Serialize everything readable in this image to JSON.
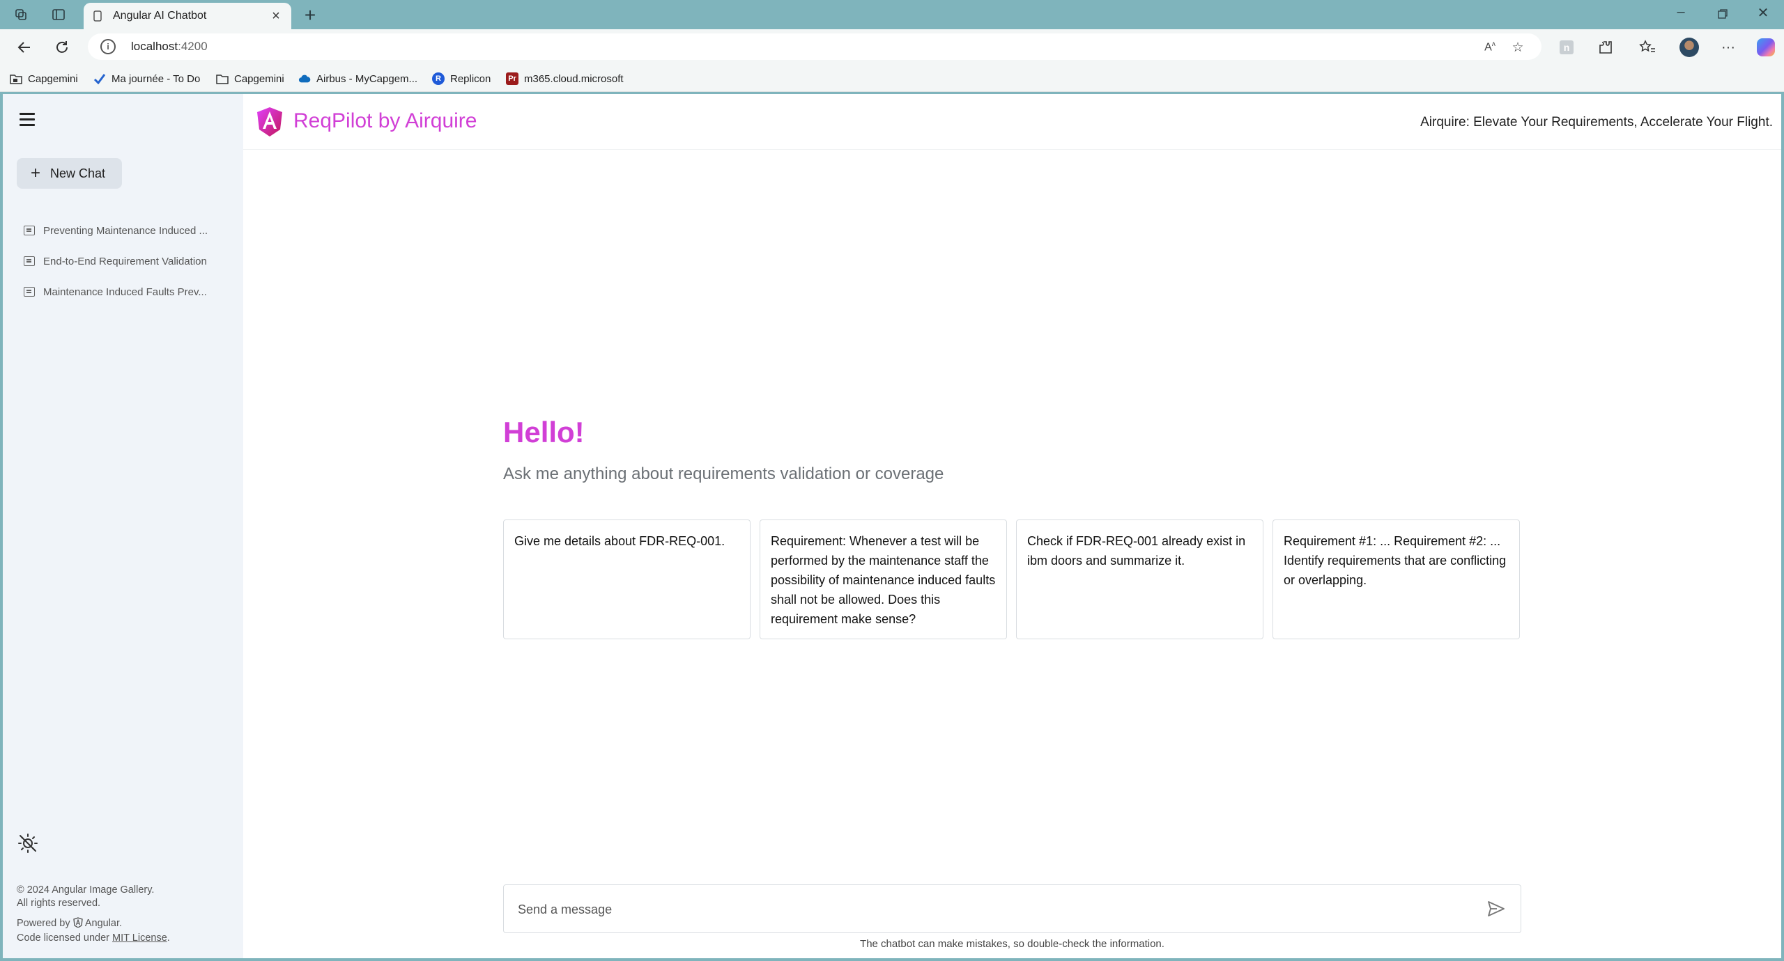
{
  "browser": {
    "tab_title": "Angular AI Chatbot",
    "url_host": "localhost",
    "url_port": ":4200",
    "bookmarks": [
      {
        "label": "Capgemini",
        "icon": "folder-lock-icon",
        "color": "#333333"
      },
      {
        "label": "Ma journée - To Do",
        "icon": "check-icon",
        "color": "#2564cf"
      },
      {
        "label": "Capgemini",
        "icon": "folder-icon",
        "color": "#333333"
      },
      {
        "label": "Airbus - MyCapgem...",
        "icon": "cloud-icon",
        "color": "#0f6cbd"
      },
      {
        "label": "Replicon",
        "icon": "replicon-icon",
        "color": "#1e5ad8"
      },
      {
        "label": "m365.cloud.microsoft",
        "icon": "pr-icon",
        "color": "#9b1c1c"
      }
    ]
  },
  "sidebar": {
    "new_chat_label": "New Chat",
    "history": [
      {
        "label": "Preventing Maintenance Induced ..."
      },
      {
        "label": "End-to-End Requirement Validation"
      },
      {
        "label": "Maintenance Induced Faults Prev..."
      }
    ],
    "footer": {
      "copyright_line1": "© 2024 Angular Image Gallery.",
      "copyright_line2": "All rights reserved.",
      "powered_prefix": "Powered by",
      "powered_name": "Angular.",
      "license_prefix": "Code licensed under",
      "license_link": "MIT License",
      "license_suffix": "."
    }
  },
  "header": {
    "brand": "ReqPilot by Airquire",
    "tagline": "Airquire: Elevate Your Requirements, Accelerate Your Flight."
  },
  "main": {
    "greeting": "Hello!",
    "subtitle": "Ask me anything about requirements validation or coverage",
    "suggestions": [
      {
        "text": "Give me details about FDR-REQ-001."
      },
      {
        "text": "Requirement: Whenever a test will be performed by the maintenance staff the possibility of maintenance induced faults shall not be allowed. Does this requirement make sense?"
      },
      {
        "text": "Check if FDR-REQ-001 already exist in ibm doors and summarize it."
      },
      {
        "text": "Requirement #1: ... Requirement #2: ... Identify requirements that are conflicting or overlapping."
      }
    ],
    "message_placeholder": "Send a message",
    "disclaimer": "The chatbot can make mistakes, so double-check the information."
  },
  "colors": {
    "accent": "#d13fd6",
    "sidebar_bg": "#f0f4f9",
    "browser_frame": "#7fb4bc"
  }
}
